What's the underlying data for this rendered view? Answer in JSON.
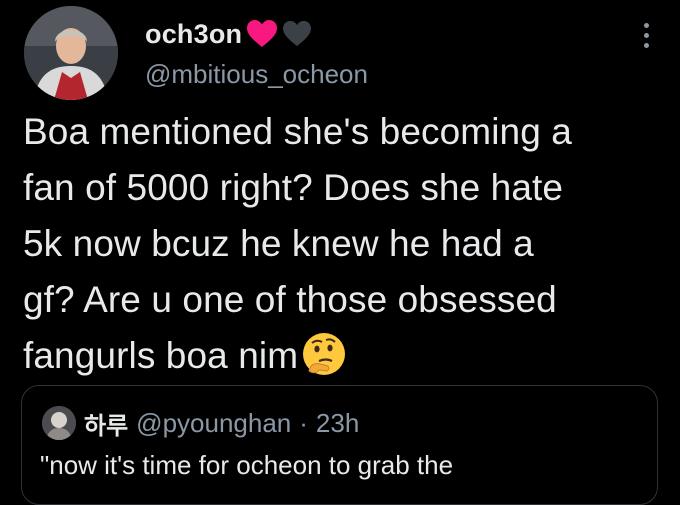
{
  "author": {
    "display_name": "och3on",
    "handle": "@mbitious_ocheon",
    "avatar_icon": "profile-photo",
    "name_emojis": [
      "red-heart-icon",
      "black-heart-icon"
    ]
  },
  "menu": {
    "icon": "more-vertical-icon"
  },
  "tweet": {
    "text": "Boa mentioned she's becoming a\nfan of 5000 right? Does she hate\n5k now bcuz he knew he had a\ngf? Are u one of those obsessed\nfangurls boa nim",
    "trailing_emoji": "thinking-face-emoji"
  },
  "quoted_tweet": {
    "display_name": "하루",
    "handle": "@pyounghan",
    "separator": "·",
    "time": "23h",
    "text": "\"now it's time for ocheon to grab the"
  },
  "colors": {
    "background": "#000000",
    "text": "#e7e9ea",
    "secondary_text": "#8b98a5",
    "border": "#2f3336",
    "heart_red": "#f91880"
  }
}
